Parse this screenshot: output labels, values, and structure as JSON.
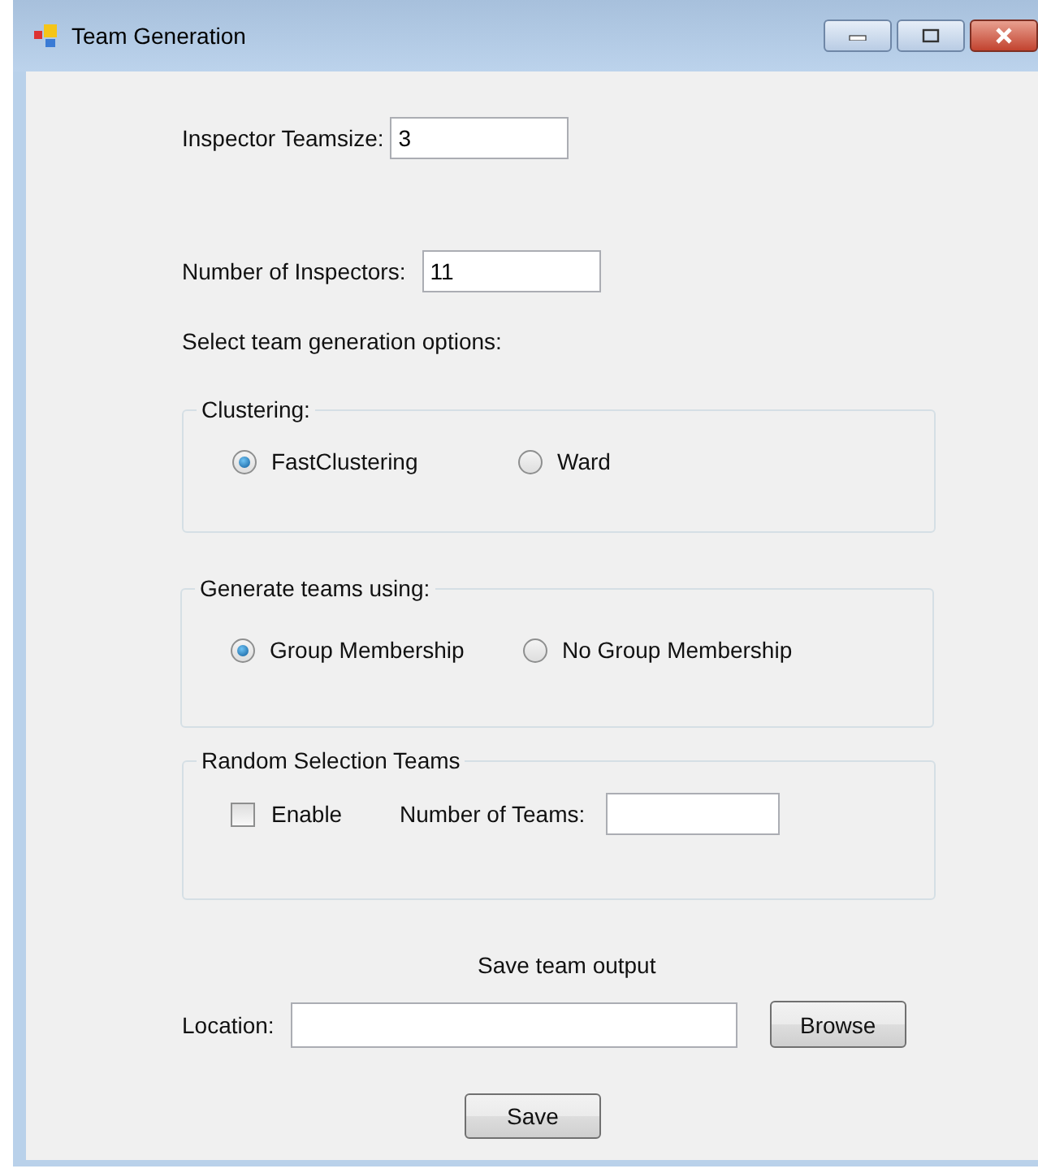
{
  "window": {
    "title": "Team Generation"
  },
  "fields": [
    {
      "label": "Inspector Teamsize:",
      "value": "3"
    },
    {
      "label": "Number of Inspectors:",
      "value": "11"
    }
  ],
  "options_heading": "Select team generation options:",
  "clustering": {
    "title": "Clustering:",
    "options": [
      {
        "label": "FastClustering",
        "selected": true
      },
      {
        "label": "Ward",
        "selected": false
      }
    ]
  },
  "generate": {
    "title": "Generate teams using:",
    "options": [
      {
        "label": "Group Membership",
        "selected": true
      },
      {
        "label": "No Group Membership",
        "selected": false
      }
    ]
  },
  "random": {
    "title": "Random Selection Teams",
    "enable": {
      "label": "Enable",
      "checked": false
    },
    "teams_label": "Number of Teams:"
  },
  "output": {
    "heading": "Save team output",
    "location_label": "Location:",
    "browse": "Browse",
    "save": "Save"
  }
}
